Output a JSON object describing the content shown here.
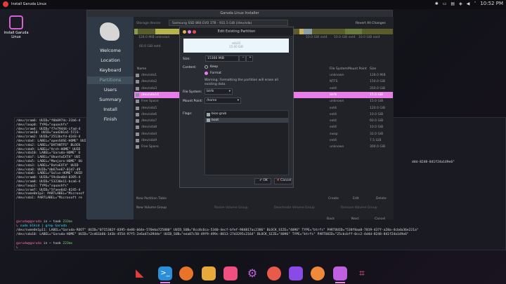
{
  "topbar": {
    "title": "Install Garuda Linux",
    "clock": "10:52 PM"
  },
  "desktop_icon": {
    "label": "Install Garuda Linux"
  },
  "installer": {
    "window_title": "Garuda Linux Installer",
    "storage_label": "Storage device:",
    "storage_value": "Samsung SSD 860 EVO 1TB - 931.5 GiB (/dev/sda)",
    "revert_label": "Revert All Changes",
    "sidebar": [
      "Welcome",
      "Location",
      "Keyboard",
      "Partitions",
      "Users",
      "Summary",
      "Install",
      "Finish"
    ],
    "bar_label_1": "128.0 MiB",
    "bar_label_1b": "unknown",
    "bar_label_2": "60.0 GiB",
    "bar_label_2b": "ext4",
    "bar_label_3": "10.0 GiB",
    "bar_label_3b": "ext4",
    "bar_label_4": "10.0 GiB",
    "bar_label_4b": "ext4",
    "bar_label_5": "10.0 GiB",
    "bar_label_5b": "ext4",
    "col_name": "Name",
    "col_fs": "File System",
    "col_mount": "Mount Point",
    "col_size": "Size",
    "rows": [
      {
        "name": "/dev/sda1",
        "fs": "unknown",
        "size": "128.0 MiB"
      },
      {
        "name": "/dev/sda2",
        "fs": "NTFS",
        "size": "150.0 GiB"
      },
      {
        "name": "/dev/sda3",
        "fs": "ext4",
        "size": "350.0 GiB"
      },
      {
        "name": "/dev/sda10",
        "fs": "btrfs",
        "size": "15.0 GiB"
      },
      {
        "name": "Free Space",
        "fs": "unknown",
        "size": "15.0 GiB"
      },
      {
        "name": "/dev/sda5",
        "fs": "ext4",
        "size": "120.0 GiB"
      },
      {
        "name": "/dev/sda6",
        "fs": "ext4",
        "size": "10.0 GiB"
      },
      {
        "name": "/dev/sda7",
        "fs": "ext4",
        "size": "60.0 GiB"
      },
      {
        "name": "/dev/sda8",
        "fs": "ext4",
        "size": "10.0 GiB"
      },
      {
        "name": "/dev/sda4",
        "fs": "swap",
        "size": "32.0 GiB"
      },
      {
        "name": "/dev/sda9",
        "fs": "ext4",
        "size": "7.5 GiB"
      },
      {
        "name": "Free Space",
        "fs": "unknown",
        "size": "300.0 GiB"
      }
    ],
    "new_table_btn": "New Partition Table",
    "create_btn": "Create",
    "edit_btn": "Edit",
    "delete_btn": "Delete",
    "new_vg_btn": "New Volume Group",
    "resize_vg_btn": "Resize Volume Group",
    "deactivate_vg_btn": "Deactivate Volume Group",
    "remove_vg_btn": "Remove Volume Group",
    "back_btn": "Back",
    "next_btn": "Next",
    "cancel_btn": "Cancel"
  },
  "dialog": {
    "title": "Edit Existing Partition",
    "preview_line1": "sda10",
    "preview_line2": "15.00 GiB",
    "size_label": "Size:",
    "size_value": "15360 MiB",
    "content_label": "Content:",
    "keep_label": "Keep",
    "format_label": "Format",
    "warning": "Warning: Formatting the partition will erase all existing data.",
    "fs_label": "File System:",
    "fs_value": "btrfs",
    "mount_label": "Mount Point:",
    "mount_value": "/home",
    "flags_label": "Flags:",
    "flags": [
      "bios-grub",
      "boot"
    ],
    "ok_label": "OK",
    "cancel_label": "Cancel"
  },
  "terminal": {
    "lines": [
      "/dev/zram6: UUID=\"f0b0974c-31b6-4",
      "/dev/loop0: TYPE=\"squashfs\"",
      "/dev/zram4: UUID=\"f7e79444-cfad-4",
      "/dev/zram10: UUID=\"aad201a5-5723-",
      "/dev/zram2: UUID=\"2513bcfd-d2d3-4",
      "/dev/sda4: LABEL=\"openSUSE-HOME\" UUI",
      "/dev/sda2: LABEL=\"DATANTFS\" BLOCK",
      "/dev/sda9: LABEL=\"Arch-HOME\" UUID",
      "/dev/sda10: LABEL=\"Garuda-HOME\" U",
      "/dev/sda7: LABEL=\"UbuntuEXT4\" UUI",
      "/dev/sda5: LABEL=\"Manjaro-HOME\" UU",
      "/dev/sda3: LABEL=\"DataEXT4\" UUID",
      "/dev/sda8: UUID=\"db67ee67-01d7-49",
      "/dev/sda6: LABEL=\"Solus-HOME\" UUID",
      "/dev/zram0: UUID=\"59c0ed0d-0395-4",
      "/dev/zram8: UUID=\"53230e11-bca6-4",
      "/dev/loop2: TYPE=\"squashfs\"",
      "/dev/zram7: UUID=\"5faee6d2-8245-4",
      "/dev/nvme0n1p2: PARTLABEL=\"Microsof",
      "/dev/sda1: PARTLABEL=\"Microsoft re"
    ],
    "right_text": "d4d-8248-841f24a149e6\"",
    "prompt1_user": "garuda@garuda",
    "prompt1_in": " in ~ took ",
    "prompt1_time": "233ms",
    "cmd": "sudo blkid | grep Garuda",
    "out1": "/dev/nvme0n1p11: LABEL=\"Garuda-ROOT\" UUID=\"0715302f-8395-4e86-b64e-570eba725880\" UUID_SUB=\"8cc8c6ca-5340-4ecf-bfef-984817ac2386\" BLOCK_SIZE=\"4096\" TYPE=\"btrfs\" PARTUUID=\"538f8aa8-7019-437f-a28a-4cbda36e221a\"",
    "out2": "/dev/sda10: LABEL=\"Garuda-HOME\" UUID=\"2cd61b66-1d3b-4554-97f5-2e6ad7a3944e\" UUID_SUB=\"eea87c50-49f9-499c-8813-27d3295c2164\" BLOCK_SIZE=\"4096\" TYPE=\"btrfs\" PARTUUID=\"25cbcbff-0cc2-4d4d-8248-841f24a149e6\"",
    "prompt2_user": "garuda@garuda",
    "prompt2_in": " in ~ took ",
    "prompt2_time": "223ms"
  },
  "colors": {
    "accent": "#e87ce8",
    "terminal_bg": "#1a1b22",
    "prompt": "#ff6ea9"
  }
}
